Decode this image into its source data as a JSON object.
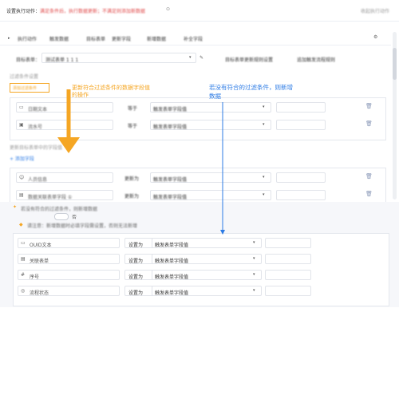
{
  "header": {
    "title": "设置执行动作：",
    "note_red": "满足条件后，执行数据更新；不满足则添加新数据",
    "note_grey": "收起执行动作",
    "help_icon": "help-circle-icon"
  },
  "tabs": [
    "执行动作",
    "触发数据",
    "目标表单",
    "更新字段",
    "新增数据",
    "补全字段"
  ],
  "target": {
    "form_label": "目标表单：",
    "form_value": "测试表单 1 1 1",
    "option_a": "目标表单更新规则设置",
    "option_b": "追加触发流程规则"
  },
  "filter_section": {
    "title": "过滤条件设置",
    "rows": [
      {
        "field": "日期文本",
        "op": "等于",
        "value": "触发表单字段值"
      },
      {
        "field": "流水号",
        "op": "等于",
        "value": "触发表单字段值"
      }
    ],
    "add_link": "添加过滤条件"
  },
  "update_section": {
    "hint": "更新目标表单中的字段值",
    "add_link": "+ 添加字段",
    "rows": [
      {
        "field": "人员信息",
        "op": "更新为",
        "value": "触发表单字段值"
      },
      {
        "field": "数据关联表单字段 ①",
        "op": "更新为",
        "value": "触发表单字段值"
      }
    ]
  },
  "insert_section": {
    "title": "若没有符合的过滤条件，则新增数据",
    "toggle_label": "否",
    "warning": "请注意：新增数据时必填字段需设置，否则无法新增",
    "rows": [
      {
        "field": "OUID文本",
        "op": "设置为",
        "value": "触发表单字段值"
      },
      {
        "field": "关联表单",
        "op": "设置为",
        "value": "触发表单字段值"
      },
      {
        "field": "序号",
        "op": "设置为",
        "value": "触发表单字段值"
      },
      {
        "field": "流程状态",
        "op": "设置为",
        "value": "触发表单字段值"
      }
    ]
  },
  "annotations": {
    "orange": "更新符合过滤条件的数据字段值\n的操作",
    "blue": "若没有符合的过滤条件，则新增\n数据"
  },
  "colors": {
    "orange": "#f5a623",
    "blue": "#2c7be5",
    "red": "#e04a4a"
  }
}
